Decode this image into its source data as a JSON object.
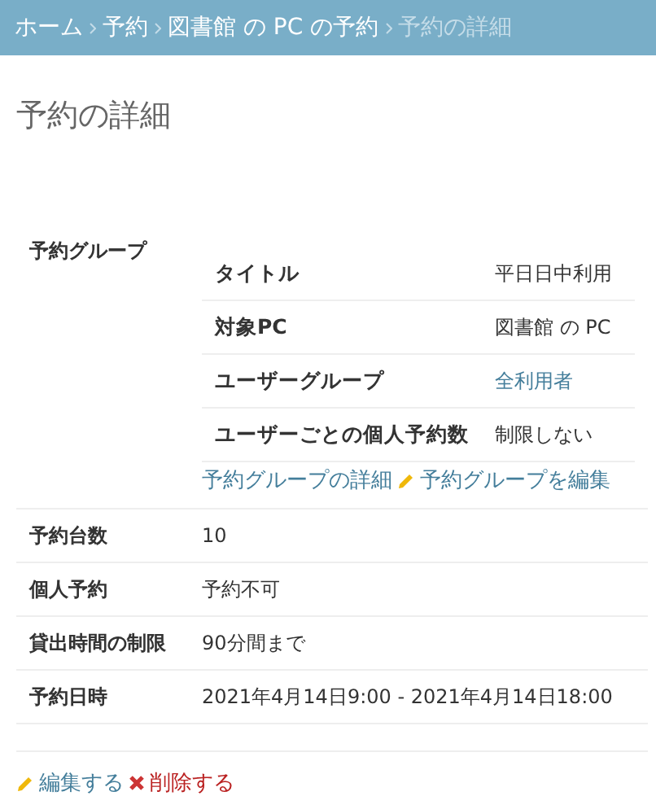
{
  "breadcrumbs": [
    {
      "label": "ホーム",
      "current": false
    },
    {
      "label": "予約",
      "current": false
    },
    {
      "label": "図書館 の PC の予約",
      "current": false
    },
    {
      "label": "予約の詳細",
      "current": true
    }
  ],
  "title": "予約の詳細",
  "rows": [
    {
      "kind": "group",
      "label": "予約グループ",
      "fields": [
        {
          "label": "タイトル",
          "value": "平日日中利用",
          "link": false
        },
        {
          "label": "対象PC",
          "value": "図書館 の PC",
          "link": false
        },
        {
          "label": "ユーザーグループ",
          "value": "全利用者",
          "link": true
        },
        {
          "label": "ユーザーごとの個人予約数",
          "value": "制限しない",
          "link": false
        }
      ],
      "links": [
        {
          "label": "予約グループの詳細",
          "kind": "view"
        },
        {
          "label": "予約グループを編集",
          "kind": "edit"
        }
      ]
    },
    {
      "kind": "text",
      "label": "予約台数",
      "value": "10"
    },
    {
      "kind": "text",
      "label": "個人予約",
      "value": "予約不可"
    },
    {
      "kind": "text",
      "label": "貸出時間の制限",
      "value": "90分間まで"
    },
    {
      "kind": "text",
      "label": "予約日時",
      "value": "2021年4月14日9:00 - 2021年4月14日18:00"
    },
    {
      "kind": "empty"
    }
  ],
  "actions": [
    {
      "label": "編集する",
      "kind": "edit"
    },
    {
      "label": "削除する",
      "kind": "delete"
    }
  ]
}
